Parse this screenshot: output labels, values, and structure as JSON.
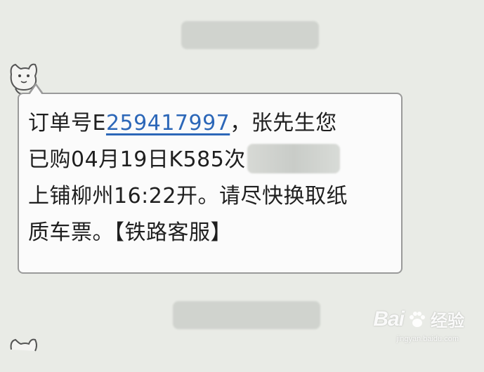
{
  "message": {
    "line1_prefix": "订单号E",
    "order_number": "259417997",
    "line1_suffix": "，张先生您",
    "line2": "已购04月19日K585次",
    "line3": "上铺柳州16:22开。请尽快换取纸",
    "line4": "质车票。【铁路客服】"
  },
  "watermark": {
    "brand_a": "Bai",
    "brand_b": "经验",
    "url": "jingyan.baidu.com"
  },
  "colors": {
    "background": "#e9ebe6",
    "bubble": "#fbfbfb",
    "link": "#2c67b8"
  }
}
